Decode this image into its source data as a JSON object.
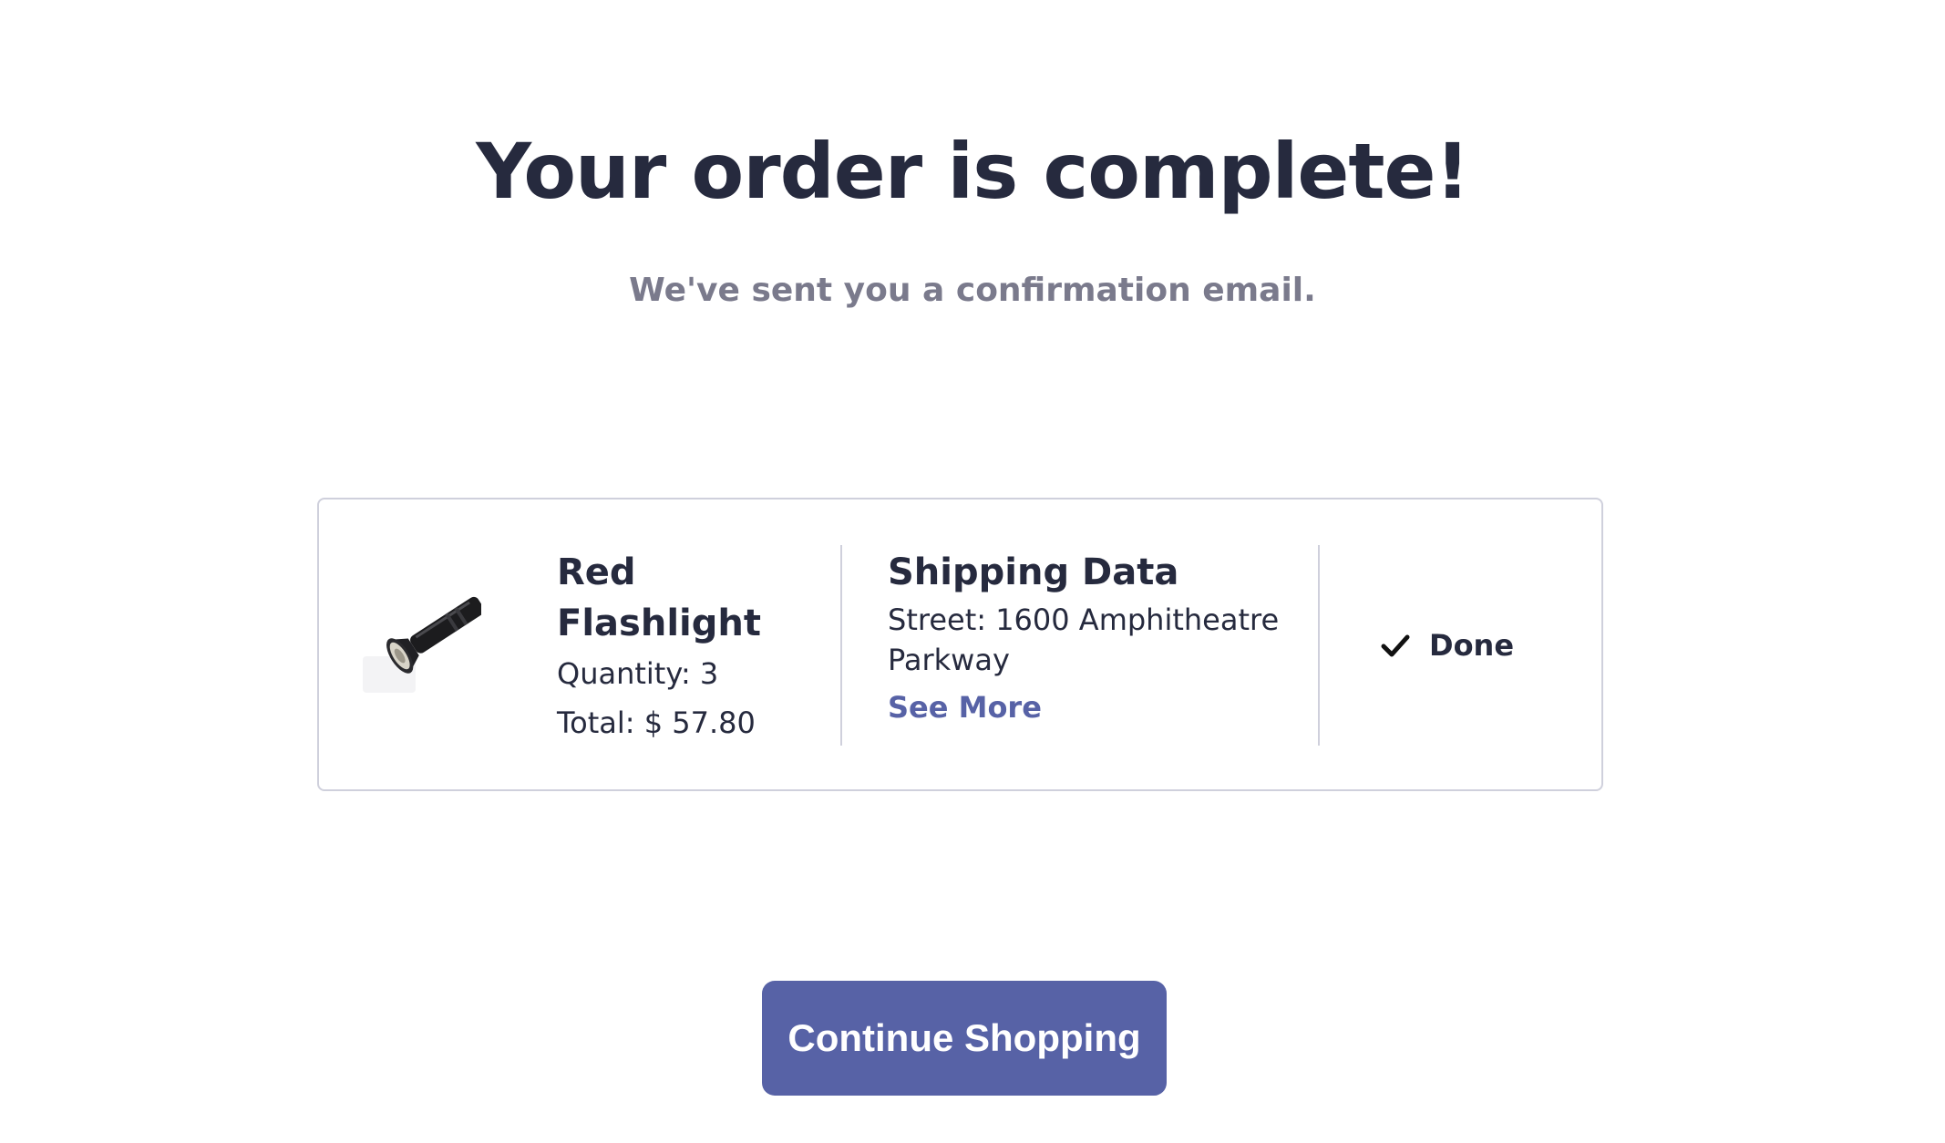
{
  "header": {
    "title": "Your order is complete!",
    "subtitle": "We've sent you a confirmation email."
  },
  "order": {
    "product": {
      "image_icon": "flashlight-image",
      "name": "Red Flashlight",
      "quantity_text": "Quantity: 3",
      "total_text": "Total: $ 57.80"
    },
    "shipping": {
      "title": "Shipping Data",
      "street_text": "Street: 1600 Amphitheatre Parkway",
      "see_more_label": "See More"
    },
    "status": {
      "icon": "check-icon",
      "label": "Done"
    }
  },
  "actions": {
    "continue_label": "Continue Shopping"
  },
  "colors": {
    "primary": "#5762a6",
    "text_dark": "#262a3e",
    "text_muted": "#7a7a8c",
    "border": "#cfd0dc"
  }
}
